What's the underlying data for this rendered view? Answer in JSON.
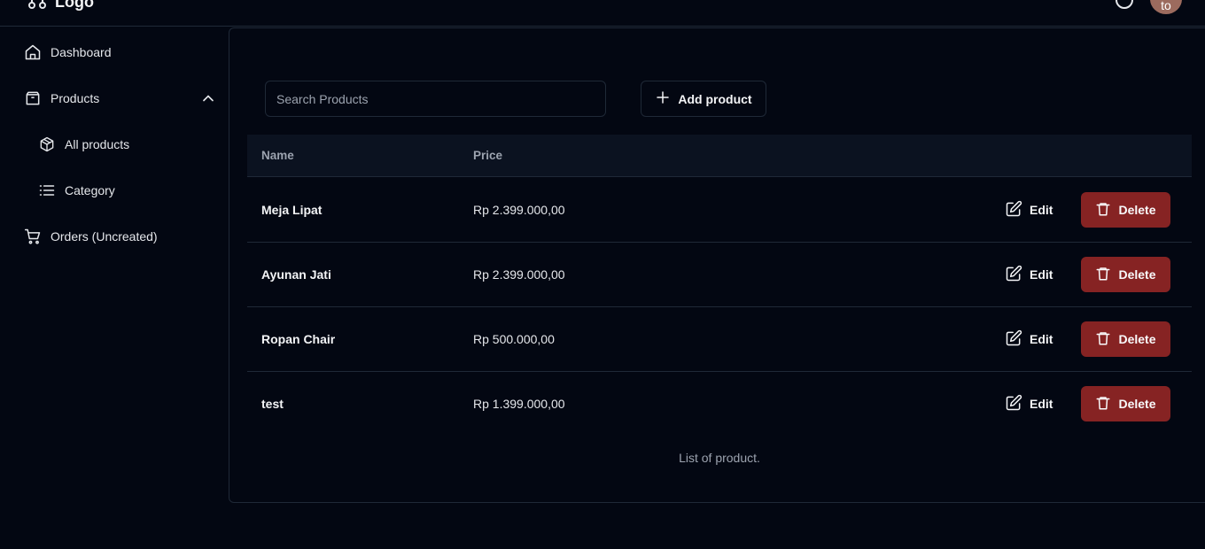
{
  "app": {
    "logo_text": "Logo",
    "avatar_initials": "to"
  },
  "sidebar": {
    "items": [
      {
        "label": "Dashboard",
        "icon": "home-icon"
      },
      {
        "label": "Products",
        "icon": "package-icon",
        "expanded": true
      },
      {
        "label": "All products",
        "icon": "boxes-icon"
      },
      {
        "label": "Category",
        "icon": "list-icon"
      },
      {
        "label": "Orders (Uncreated)",
        "icon": "cart-icon"
      }
    ]
  },
  "toolbar": {
    "search_placeholder": "Search Products",
    "add_label": "Add product"
  },
  "table": {
    "columns": [
      "Name",
      "Price"
    ],
    "rows": [
      {
        "name": "Meja Lipat",
        "price": "Rp 2.399.000,00"
      },
      {
        "name": "Ayunan Jati",
        "price": "Rp 2.399.000,00"
      },
      {
        "name": "Ropan Chair",
        "price": "Rp 500.000,00"
      },
      {
        "name": "test",
        "price": "Rp 1.399.000,00"
      }
    ],
    "edit_label": "Edit",
    "delete_label": "Delete",
    "caption": "List of product."
  },
  "colors": {
    "background": "#030712",
    "border": "#1f2937",
    "delete": "#862323"
  }
}
